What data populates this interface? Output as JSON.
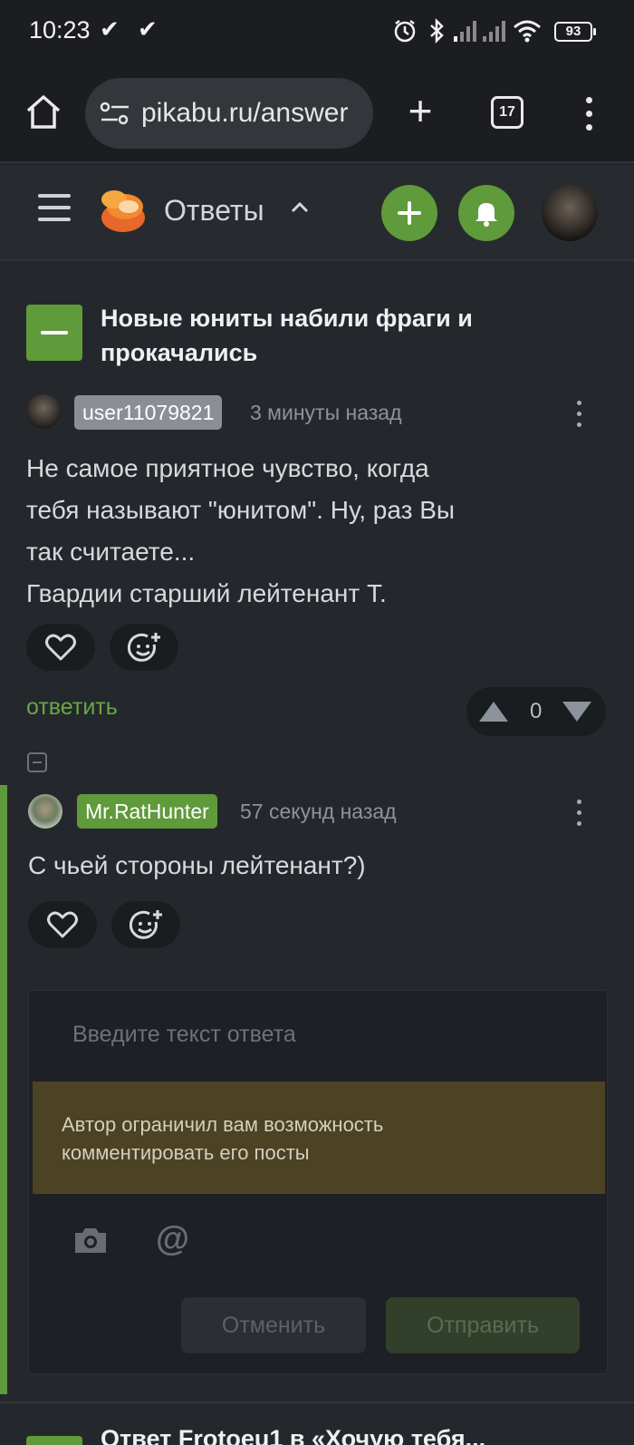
{
  "status_bar": {
    "time": "10:23",
    "battery": "93"
  },
  "browser": {
    "url": "pikabu.ru/answer",
    "tab_count": "17"
  },
  "site_header": {
    "section_title": "Ответы"
  },
  "post": {
    "title": "Новые юниты набили фраги и прокачались"
  },
  "comments": [
    {
      "username": "user11079821",
      "username_color": "#8a8f96",
      "time": "3 минуты назад",
      "lines": [
        "Не самое приятное чувство, когда",
        "тебя называют \"юнитом\". Ну, раз Вы",
        "так считаете...",
        "Гвардии старший лейтенант Т."
      ],
      "reply_label": "ответить",
      "rating": "0"
    },
    {
      "username": "Mr.RatHunter",
      "username_color": "#5f9a3b",
      "time": "57 секунд назад",
      "lines": [
        "С чьей стороны лейтенант?)"
      ]
    }
  ],
  "reply_form": {
    "placeholder": "Введите текст ответа",
    "warning_line1": "Автор ограничил вам возможность",
    "warning_line2": "комментировать его посты",
    "cancel_label": "Отменить",
    "send_label": "Отправить"
  },
  "next_post": {
    "title": "Ответ Frotoeu1 в «Хочую тебя..."
  },
  "colors": {
    "accent": "#5f9a3b",
    "background": "#24282d",
    "warning_bg": "#4b4324"
  }
}
